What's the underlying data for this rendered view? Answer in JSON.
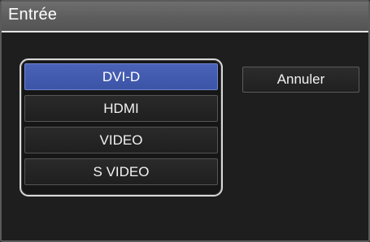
{
  "dialog": {
    "title": "Entrée"
  },
  "options": [
    {
      "label": "DVI-D",
      "selected": true
    },
    {
      "label": "HDMI",
      "selected": false
    },
    {
      "label": "VIDEO",
      "selected": false
    },
    {
      "label": "S VIDEO",
      "selected": false
    }
  ],
  "buttons": {
    "cancel_label": "Annuler"
  },
  "colors": {
    "selected_accent": "#4159ad",
    "frame_border": "#d8d8d8",
    "title_bar": "#5f5f5f",
    "background": "#1e1e1e"
  }
}
